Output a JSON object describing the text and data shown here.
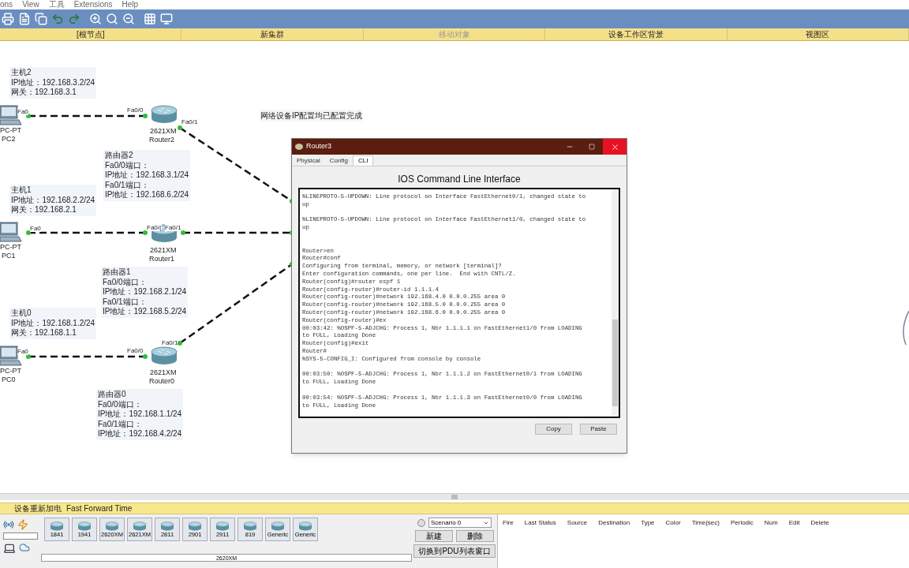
{
  "menu": [
    "ons",
    "View",
    "工具",
    "Extensions",
    "Help"
  ],
  "workspace_bar": [
    {
      "label": "[根节点]",
      "disabled": false
    },
    {
      "label": "新集群",
      "disabled": false
    },
    {
      "label": "移动对象",
      "disabled": true
    },
    {
      "label": "设备工作区背景",
      "disabled": false
    },
    {
      "label": "视图区",
      "disabled": false
    }
  ],
  "canvas": {
    "message": "网络设备IP配置均已配置完成",
    "devices": [
      {
        "kind": "pc",
        "model": "PC-PT",
        "name": "PC2",
        "ports": [
          "Fa0"
        ]
      },
      {
        "kind": "router",
        "model": "2621XM",
        "name": "Router2",
        "ports": [
          "Fa0/0",
          "Fa0/1"
        ]
      },
      {
        "kind": "pc",
        "model": "PC-PT",
        "name": "PC1",
        "ports": [
          "Fa0"
        ]
      },
      {
        "kind": "router",
        "model": "2621XM",
        "name": "Router1",
        "ports": [
          "Fa0/(",
          "Fa0/1"
        ]
      },
      {
        "kind": "pc",
        "model": "PC-PT",
        "name": "PC0",
        "ports": [
          "Fa0"
        ]
      },
      {
        "kind": "router",
        "model": "2621XM",
        "name": "Router0",
        "ports": [
          "Fa0/0",
          "Fa0/1"
        ]
      }
    ],
    "notes": [
      [
        "主机2",
        "IP地址：192.168.3.2/24",
        "网关：192.168.3.1"
      ],
      [
        "路由器2",
        "Fa0/0端口：",
        "IP地址：192.168.3.1/24",
        "Fa0/1端口：",
        "IP地址：192.168.6.2/24"
      ],
      [
        "主机1",
        "IP地址：192.168.2.2/24",
        "网关：192.168.2.1"
      ],
      [
        "路由器1",
        "Fa0/0端口：",
        "IP地址：192.168.2.1/24",
        "Fa0/1端口：",
        "IP地址：192.168.5.2/24"
      ],
      [
        "主机0",
        "IP地址：192.168.1.2/24",
        "网关：192.168.1.1"
      ],
      [
        "路由器0",
        "Fa0/0端口：",
        "IP地址：192.168.1.1/24",
        "Fa0/1端口：",
        "IP地址：192.168.4.2/24"
      ]
    ]
  },
  "dialog": {
    "title": "Router3",
    "tabs": [
      {
        "label": "Physical",
        "selected": false
      },
      {
        "label": "Config",
        "selected": false
      },
      {
        "label": "CLI",
        "selected": true
      }
    ],
    "heading": "IOS Command Line Interface",
    "console_blocks": [
      [
        "%LINEPROTO-5-UPDOWN: Line protocol on Interface FastEthernet0/1, changed state to",
        "up"
      ],
      [
        "%LINEPROTO-5-UPDOWN: Line protocol on Interface FastEthernet1/0, changed state to",
        "up"
      ],
      [
        "Router>en",
        "Router#conf",
        "Configuring from terminal, memory, or network [terminal]?",
        "Enter configuration commands, one per line.  End with CNTL/Z.",
        "Router(config)#router ospf 1",
        "Router(config-router)#router-id 1.1.1.4",
        "Router(config-router)#network 192.168.4.0 0.0.0.255 area 0",
        "Router(config-router)#network 192.168.5.0 0.0.0.255 area 0",
        "Router(config-router)#network 192.168.6.0 0.0.0.255 area 0",
        "Router(config-router)#ex",
        "00:03:42: %OSPF-5-ADJCHG: Process 1, Nbr 1.1.1.1 on FastEthernet1/0 from LOADING",
        "to FULL, Loading Done",
        "Router(config)#exit",
        "Router#",
        "%SYS-5-CONFIG_I: Configured from console by console"
      ],
      [
        "00:03:50: %OSPF-5-ADJCHG: Process 1, Nbr 1.1.1.2 on FastEthernet0/1 from LOADING",
        "to FULL, Loading Done"
      ],
      [
        "00:03:54: %OSPF-5-ADJCHG: Process 1, Nbr 1.1.1.3 on FastEthernet0/0 from LOADING",
        "to FULL, Loading Done"
      ]
    ],
    "buttons": [
      "Copy",
      "Paste"
    ]
  },
  "status_bar": [
    "设备重新加电",
    "Fast Forward Time"
  ],
  "device_palette": {
    "models": [
      "1841",
      "1941",
      "2620XM",
      "2621XM",
      "2811",
      "2901",
      "2911",
      "819",
      "Generic",
      "Generic"
    ],
    "selected_model": "2620XM"
  },
  "scenario": {
    "value": "Scenario 0",
    "buttons": [
      "新建",
      "删除"
    ],
    "toggle_button": "切换到PDU列表窗口"
  },
  "pdu_columns": [
    "Fire",
    "Last Status",
    "Source",
    "Destination",
    "Type",
    "Color",
    "Time(sec)",
    "Periodic",
    "Num",
    "Edit",
    "Delete"
  ]
}
